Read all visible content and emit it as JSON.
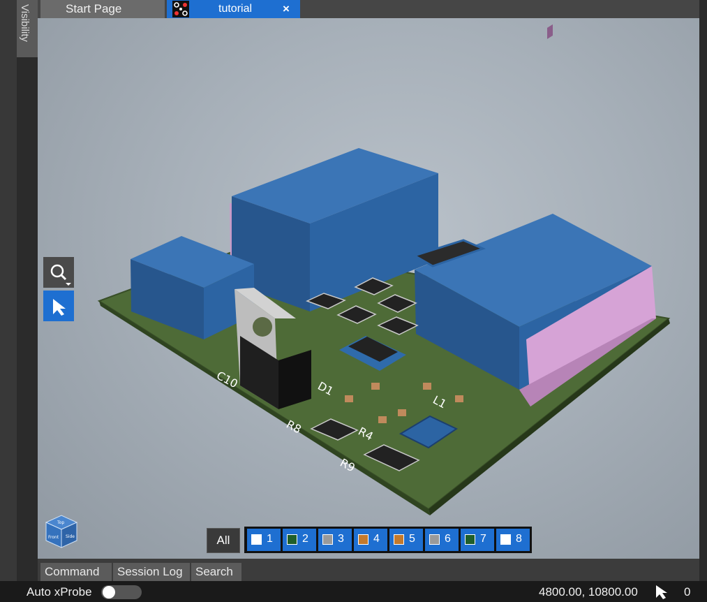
{
  "sidebar": {
    "visibility_label": "Visibility"
  },
  "tabs": {
    "start_page": "Start Page",
    "tutorial": "tutorial",
    "close_glyph": "×"
  },
  "viewport": {
    "silkscreen_labels": [
      "C10",
      "R8",
      "R9",
      "R4",
      "L1",
      "D1"
    ],
    "orientation_cube_faces": [
      "Top",
      "Front",
      "Side"
    ]
  },
  "layers": {
    "all_label": "All",
    "items": [
      {
        "num": "1",
        "color": "#ffffff"
      },
      {
        "num": "2",
        "color": "#1f5f2b"
      },
      {
        "num": "3",
        "color": "#9a9a9a"
      },
      {
        "num": "4",
        "color": "#c47a2c"
      },
      {
        "num": "5",
        "color": "#c47a2c"
      },
      {
        "num": "6",
        "color": "#9a9a9a"
      },
      {
        "num": "7",
        "color": "#1f5f2b"
      },
      {
        "num": "8",
        "color": "#ffffff"
      }
    ]
  },
  "bottom_tabs": [
    "Command",
    "Session Log",
    "Search"
  ],
  "status": {
    "auto_xprobe": "Auto xProbe",
    "coordinates": "4800.00, 10800.00",
    "count": "0"
  },
  "colors": {
    "accent": "#1e6fd1",
    "component_blue": "#2f6bab",
    "pcb_green": "#4e6b37",
    "connector_pink": "#d6a3d6"
  }
}
